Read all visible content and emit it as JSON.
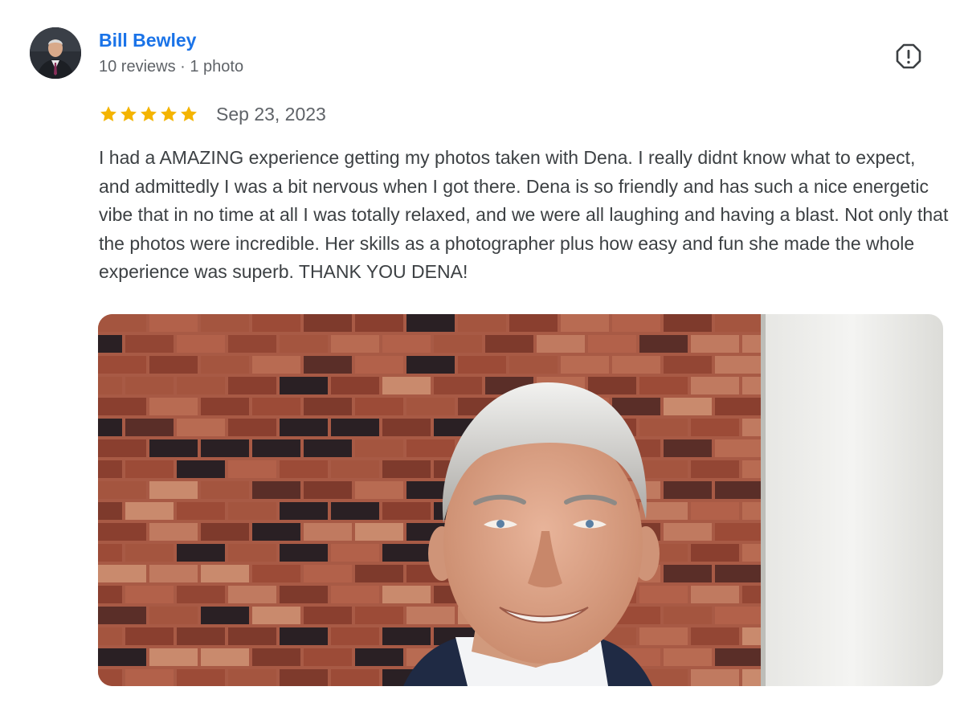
{
  "reviewer": {
    "name": "Bill Bewley",
    "meta": "10 reviews · 1 photo"
  },
  "review": {
    "rating": 5,
    "max_rating": 5,
    "date": "Sep 23, 2023",
    "text": "I had a AMAZING experience getting my photos taken with Dena. I really didnt know what to expect, and admittedly I was a bit nervous when I got there. Dena is so friendly and has such a nice energetic vibe that in no time at all I was totally relaxed, and we were all laughing and having a blast. Not only that the photos were incredible. Her skills as a photographer plus how easy and fun she made the whole experience was superb. THANK YOU DENA!"
  },
  "icons": {
    "report": "report-flag-icon",
    "star": "star-icon"
  },
  "colors": {
    "name_link": "#1a73e8",
    "star": "#f4b400",
    "meta_text": "#5f6368",
    "body_text": "#3c4043"
  }
}
